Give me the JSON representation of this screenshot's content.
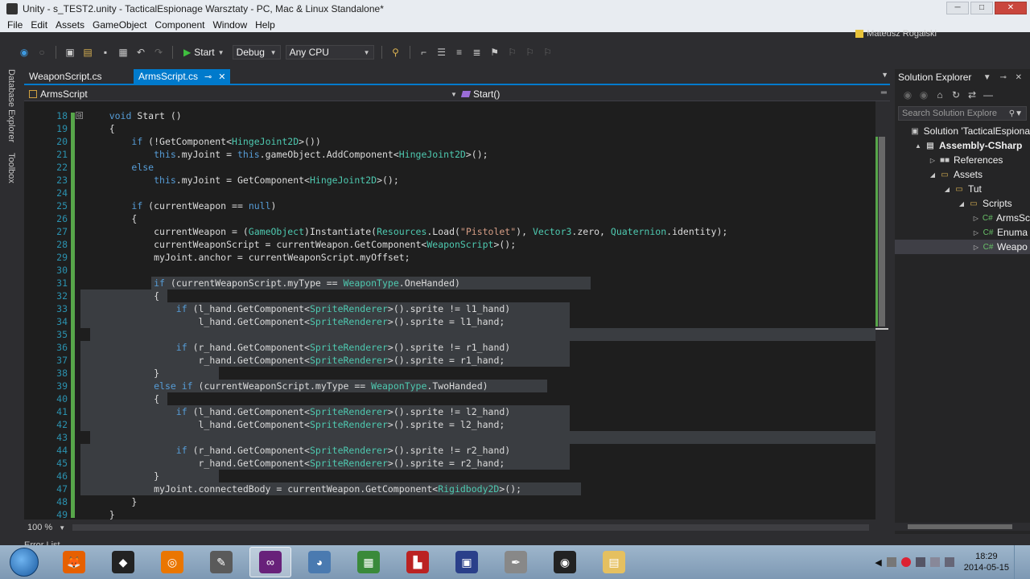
{
  "unity_window": {
    "title": "Unity - s_TEST2.unity - TacticalEspionage Warsztaty - PC, Mac & Linux Standalone*",
    "menu": [
      "File",
      "Edit",
      "Assets",
      "GameObject",
      "Component",
      "Window",
      "Help"
    ]
  },
  "vs": {
    "user_name": "Mateusz Rogalski",
    "toolbar": {
      "start_label": "Start",
      "config": "Debug",
      "platform": "Any CPU"
    },
    "left_tabs": [
      "Database Explorer",
      "Toolbox"
    ],
    "tabs": [
      {
        "label": "WeaponScript.cs",
        "active": false
      },
      {
        "label": "ArmsScript.cs",
        "active": true
      }
    ],
    "nav": {
      "class_combo": "ArmsScript",
      "member_combo": "Start()"
    },
    "zoom": "100 %",
    "error_list": "Error List"
  },
  "code": {
    "lines": [
      {
        "n": "18",
        "t": "    void Start ()"
      },
      {
        "n": "19",
        "t": "    {"
      },
      {
        "n": "20",
        "t": "        if (!GetComponent<HingeJoint2D>())"
      },
      {
        "n": "21",
        "t": "            this.myJoint = this.gameObject.AddComponent<HingeJoint2D>();"
      },
      {
        "n": "22",
        "t": "        else"
      },
      {
        "n": "23",
        "t": "            this.myJoint = GetComponent<HingeJoint2D>();"
      },
      {
        "n": "24",
        "t": ""
      },
      {
        "n": "25",
        "t": "        if (currentWeapon == null)"
      },
      {
        "n": "26",
        "t": "        {"
      },
      {
        "n": "27",
        "t": "            currentWeapon = (GameObject)Instantiate(Resources.Load(\"Pistolet\"), Vector3.zero, Quaternion.identity);"
      },
      {
        "n": "28",
        "t": "            currentWeaponScript = currentWeapon.GetComponent<WeaponScript>();"
      },
      {
        "n": "29",
        "t": "            myJoint.anchor = currentWeaponScript.myOffset;"
      },
      {
        "n": "30",
        "t": ""
      },
      {
        "n": "31",
        "t": "            if (currentWeaponScript.myType == WeaponType.OneHanded)"
      },
      {
        "n": "32",
        "t": "            {"
      },
      {
        "n": "33",
        "t": "                if (l_hand.GetComponent<SpriteRenderer>().sprite != l1_hand)"
      },
      {
        "n": "34",
        "t": "                    l_hand.GetComponent<SpriteRenderer>().sprite = l1_hand;"
      },
      {
        "n": "35",
        "t": ""
      },
      {
        "n": "36",
        "t": "                if (r_hand.GetComponent<SpriteRenderer>().sprite != r1_hand)"
      },
      {
        "n": "37",
        "t": "                    r_hand.GetComponent<SpriteRenderer>().sprite = r1_hand;"
      },
      {
        "n": "38",
        "t": "            }"
      },
      {
        "n": "39",
        "t": "            else if (currentWeaponScript.myType == WeaponType.TwoHanded)"
      },
      {
        "n": "40",
        "t": "            {"
      },
      {
        "n": "41",
        "t": "                if (l_hand.GetComponent<SpriteRenderer>().sprite != l2_hand)"
      },
      {
        "n": "42",
        "t": "                    l_hand.GetComponent<SpriteRenderer>().sprite = l2_hand;"
      },
      {
        "n": "43",
        "t": ""
      },
      {
        "n": "44",
        "t": "                if (r_hand.GetComponent<SpriteRenderer>().sprite != r2_hand)"
      },
      {
        "n": "45",
        "t": "                    r_hand.GetComponent<SpriteRenderer>().sprite = r2_hand;"
      },
      {
        "n": "46",
        "t": "            }"
      },
      {
        "n": "47",
        "t": "            myJoint.connectedBody = currentWeapon.GetComponent<Rigidbody2D>();"
      },
      {
        "n": "48",
        "t": "        }"
      },
      {
        "n": "49",
        "t": "    }"
      }
    ]
  },
  "solution_explorer": {
    "title": "Solution Explorer",
    "search_placeholder": "Search Solution Explore",
    "tree": [
      {
        "label": "Solution 'TacticalEspiona",
        "indent": 0,
        "expander": "",
        "icon": "solution-icon",
        "bold": false,
        "selected": false
      },
      {
        "label": "Assembly-CSharp",
        "indent": 1,
        "expander": "▲",
        "icon": "csharp-project-icon",
        "bold": true,
        "selected": false
      },
      {
        "label": "References",
        "indent": 2,
        "expander": "▷",
        "icon": "references-icon",
        "bold": false,
        "selected": false
      },
      {
        "label": "Assets",
        "indent": 2,
        "expander": "◢",
        "icon": "folder-icon",
        "bold": false,
        "selected": false
      },
      {
        "label": "Tut",
        "indent": 3,
        "expander": "◢",
        "icon": "folder-icon",
        "bold": false,
        "selected": false
      },
      {
        "label": "Scripts",
        "indent": 4,
        "expander": "◢",
        "icon": "folder-icon",
        "bold": false,
        "selected": false
      },
      {
        "label": "ArmsSc",
        "indent": 5,
        "expander": "▷",
        "icon": "csharp-file-icon",
        "bold": false,
        "selected": false
      },
      {
        "label": "Enuma",
        "indent": 5,
        "expander": "▷",
        "icon": "csharp-file-icon",
        "bold": false,
        "selected": false
      },
      {
        "label": "Weapo",
        "indent": 5,
        "expander": "▷",
        "icon": "csharp-file-icon",
        "bold": false,
        "selected": true
      }
    ]
  },
  "taskbar": {
    "apps": [
      "firefox-icon",
      "unity-icon",
      "blender-icon",
      "gimp-icon",
      "visual-studio-icon",
      "app-icon",
      "chart-app-icon",
      "filezilla-icon",
      "virtualbox-icon",
      "inkscape-icon",
      "obs-icon",
      "explorer-icon"
    ],
    "time": "18:29",
    "date": "2014-05-15"
  }
}
